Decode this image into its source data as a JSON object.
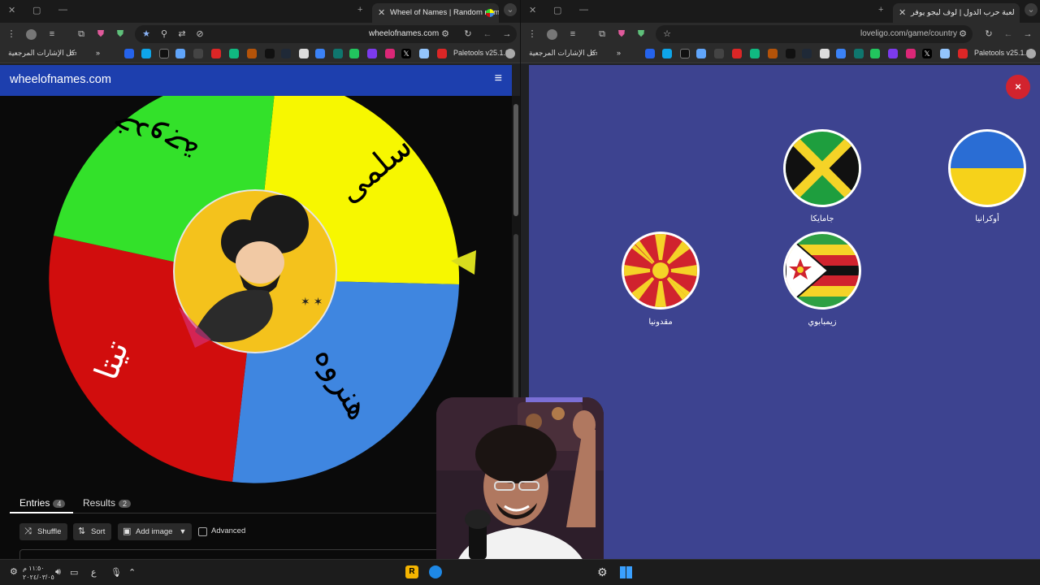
{
  "left_window": {
    "tab_title": "Wheel of Names | Random nam",
    "url": "wheelofnames.com",
    "bookmarks_folder": "كل الإشارات المرجعية",
    "paletools": "Paletools v25.1.9"
  },
  "right_window": {
    "tab_title": "لعبة حرب الدول | لوف ليجو يوفر",
    "url": "loveligo.com/game/country",
    "bookmarks_folder": "كل الإشارات المرجعية",
    "paletools": "Paletools v25.1.9"
  },
  "wheel_app": {
    "site_title": "wheelofnames.com",
    "wheel_segments": [
      {
        "label": "سلمى",
        "color": "#f7f700"
      },
      {
        "label": "هنروه",
        "color": "#3f86e0"
      },
      {
        "label": "تيتا",
        "color": "#d10d0d"
      },
      {
        "label": "خدوجة",
        "color": "#33e12a"
      }
    ],
    "tabs": [
      {
        "label": "Entries",
        "count": "4"
      },
      {
        "label": "Results",
        "count": "2"
      }
    ],
    "buttons": {
      "shuffle": "Shuffle",
      "sort": "Sort",
      "add_image": "Add image",
      "advanced": "Advanced"
    }
  },
  "country_game": {
    "close_label": "×",
    "countries": [
      {
        "name": "أوكرانيا",
        "flag": "ukraine"
      },
      {
        "name": "جامايكا",
        "flag": "jamaica"
      },
      {
        "name": "زيمبابوي",
        "flag": "zimbabwe"
      },
      {
        "name": "مقدونيا",
        "flag": "north-macedonia"
      }
    ]
  },
  "taskbar": {
    "time": "١١:٥٠ م",
    "date": "٢٠٢٤/٠٣/٠٥",
    "lang": "ع"
  },
  "colors": {
    "wheel_header": "#1d3fae",
    "game_bg": "#3d4390",
    "close": "#d2232e"
  }
}
